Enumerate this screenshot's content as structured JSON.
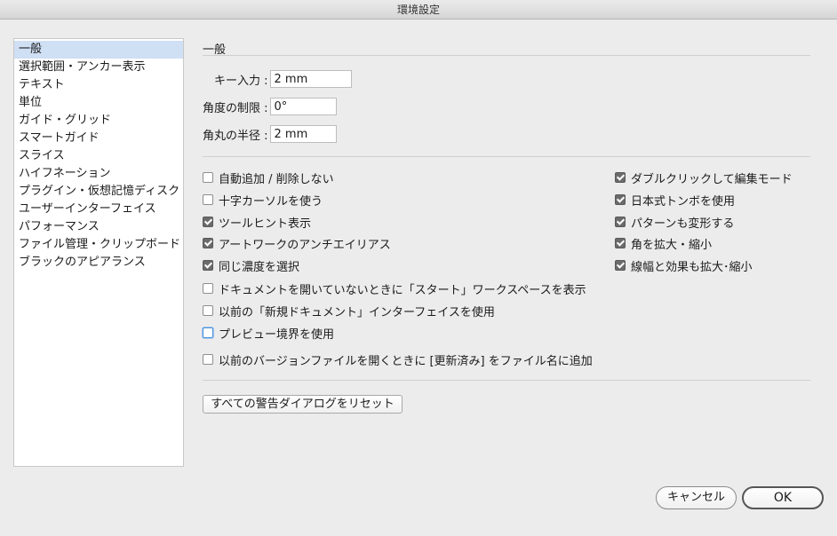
{
  "window": {
    "title": "環境設定"
  },
  "sidebar": {
    "items": [
      {
        "label": "一般",
        "selected": true
      },
      {
        "label": "選択範囲・アンカー表示"
      },
      {
        "label": "テキスト"
      },
      {
        "label": "単位"
      },
      {
        "label": "ガイド・グリッド"
      },
      {
        "label": "スマートガイド"
      },
      {
        "label": "スライス"
      },
      {
        "label": "ハイフネーション"
      },
      {
        "label": "プラグイン・仮想記憶ディスク"
      },
      {
        "label": "ユーザーインターフェイス"
      },
      {
        "label": "パフォーマンス"
      },
      {
        "label": "ファイル管理・クリップボード"
      },
      {
        "label": "ブラックのアピアランス"
      }
    ]
  },
  "main": {
    "section_title": "一般",
    "fields": {
      "key_input": {
        "label": "キー入力 :",
        "value": "2 mm"
      },
      "angle_limit": {
        "label": "角度の制限 :",
        "value": "0°"
      },
      "corner_radius": {
        "label": "角丸の半径 :",
        "value": "2 mm"
      }
    },
    "left_checks": [
      {
        "label": "自動追加 / 削除しない",
        "checked": false
      },
      {
        "label": "十字カーソルを使う",
        "checked": false
      },
      {
        "label": "ツールヒント表示",
        "checked": true
      },
      {
        "label": "アートワークのアンチエイリアス",
        "checked": true
      },
      {
        "label": "同じ濃度を選択",
        "checked": true
      },
      {
        "label": "ドキュメントを開いていないときに「スタート」ワークスペースを表示",
        "checked": false
      },
      {
        "label": "以前の「新規ドキュメント」インターフェイスを使用",
        "checked": false
      },
      {
        "label": "プレビュー境界を使用",
        "checked": false
      },
      {
        "label": "以前のバージョンファイルを開くときに [更新済み] をファイル名に追加",
        "checked": false
      }
    ],
    "right_checks": [
      {
        "label": "ダブルクリックして編集モード",
        "checked": true
      },
      {
        "label": "日本式トンボを使用",
        "checked": true
      },
      {
        "label": "パターンも変形する",
        "checked": true
      },
      {
        "label": "角を拡大・縮小",
        "checked": true
      },
      {
        "label": "線幅と効果も拡大･縮小",
        "checked": true
      }
    ],
    "reset_button": "すべての警告ダイアログをリセット"
  },
  "footer": {
    "cancel_label": "キャンセル",
    "ok_label": "OK"
  }
}
